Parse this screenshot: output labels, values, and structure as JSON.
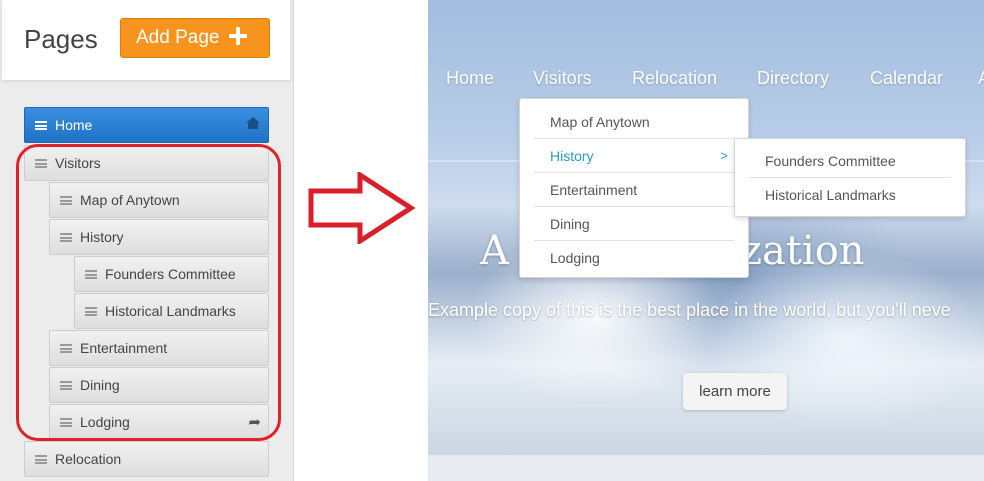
{
  "left_panel": {
    "title": "Pages",
    "add_button_label": "Add Page",
    "tree": {
      "home": "Home",
      "visitors": "Visitors",
      "map_of_anytown": "Map of Anytown",
      "history": "History",
      "founders_committee": "Founders Committee",
      "historical_landmarks": "Historical Landmarks",
      "entertainment": "Entertainment",
      "dining": "Dining",
      "lodging": "Lodging",
      "relocation": "Relocation"
    },
    "colors": {
      "add_button": "#f7941d",
      "active_item": "#2a80d4",
      "highlight_frame": "#e0212a"
    }
  },
  "site": {
    "nav": [
      "Home",
      "Visitors",
      "Relocation",
      "Directory",
      "Calendar",
      "A"
    ],
    "dropdown": [
      "Map of Anytown",
      "History",
      "Entertainment",
      "Dining",
      "Lodging"
    ],
    "submenu": [
      "Founders Committee",
      "Historical Landmarks"
    ],
    "submenu_caret": ">",
    "hero_title_left": "A",
    "hero_title_right": "ganization",
    "hero_copy": "Example copy of this is the best place in the world, but you'll neve",
    "cta_label": "learn more",
    "colors": {
      "highlight_link": "#1fa0c8"
    }
  }
}
